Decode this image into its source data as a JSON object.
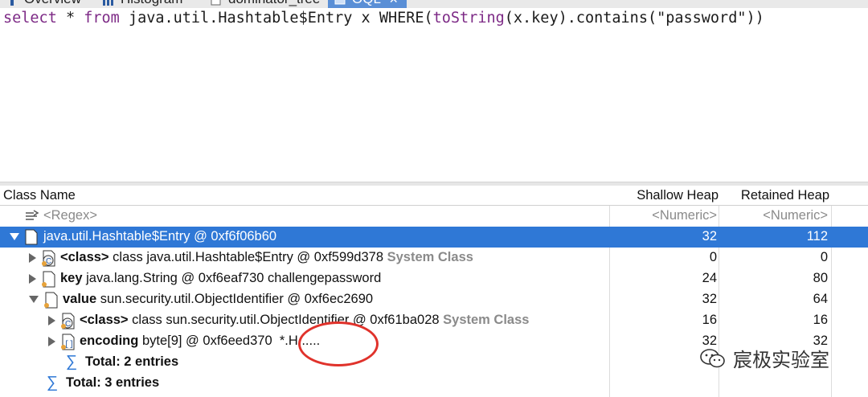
{
  "tabs": [
    {
      "label": "Overview",
      "icon": "overview-icon"
    },
    {
      "label": "Histogram",
      "icon": "histogram-icon"
    },
    {
      "label": "dominator_tree",
      "icon": "tree-icon"
    },
    {
      "label": "OQL",
      "icon": "oql-icon",
      "active": true
    }
  ],
  "query": {
    "select": "select",
    "star": " * ",
    "from": "from",
    "rest1": " java.util.Hashtable$Entry x WHERE(",
    "fn": "toString",
    "rest2": "(x.key).contains(\"password\"))"
  },
  "table": {
    "headers": {
      "class_name": "Class Name",
      "shallow": "Shallow Heap",
      "retained": "Retained Heap"
    },
    "filter": {
      "regex": "<Regex>",
      "shallow": "<Numeric>",
      "retained": "<Numeric>"
    },
    "rows": [
      {
        "name": "java.util.Hashtable$Entry @ 0xf6f06b60",
        "shallow": "32",
        "retained": "112"
      },
      {
        "label": "<class>",
        "name": "class java.util.Hashtable$Entry @ 0xf599d378",
        "suffix": "System Class",
        "shallow": "0",
        "retained": "0"
      },
      {
        "label": "key",
        "name": "java.lang.String @ 0xf6eaf730  challengepassword",
        "shallow": "24",
        "retained": "80"
      },
      {
        "label": "value",
        "name": "sun.security.util.ObjectIdentifier @ 0xf6ec2690",
        "shallow": "32",
        "retained": "64"
      },
      {
        "label": "<class>",
        "name": "class sun.security.util.ObjectIdentifier @ 0xf61ba028",
        "suffix": "System Class",
        "shallow": "16",
        "retained": "16"
      },
      {
        "label": "encoding",
        "name": "byte[9] @ 0xf6eed370",
        "suffix": "*.H......",
        "shallow": "32",
        "retained": "32"
      },
      {
        "total": "Total: 2 entries"
      },
      {
        "total": "Total: 3 entries"
      }
    ]
  },
  "watermark": {
    "text": "宸极实验室"
  }
}
